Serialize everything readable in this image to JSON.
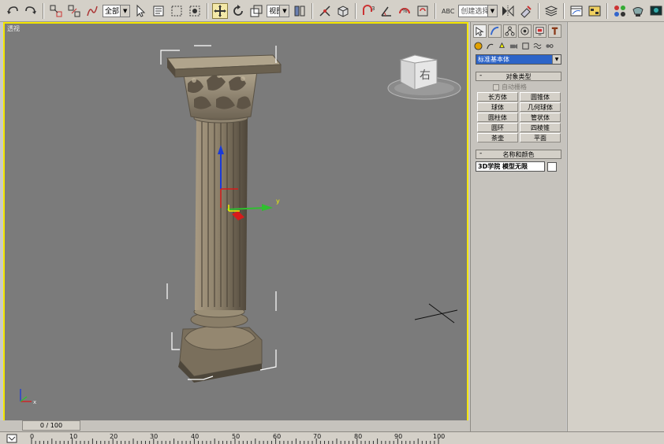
{
  "toolbar": {
    "selection_filter": "全部",
    "reference_coord": "视图",
    "named_selection_set": "创建选择集",
    "active_tool": "move-tool"
  },
  "viewport": {
    "label": "透视",
    "viewcube_face": "右",
    "axis_y_label": "y",
    "axis_x_label": "x",
    "gizmo_y_label": "y"
  },
  "command_panel": {
    "category": "标准基本体",
    "object_type_title": "对象类型",
    "auto_grid_label": "自动栅格",
    "object_buttons": [
      "长方体",
      "圆锥体",
      "球体",
      "几何球体",
      "圆柱体",
      "管状体",
      "圆环",
      "四棱锥",
      "茶壶",
      "平面"
    ],
    "name_color_title": "名称和颜色",
    "object_name": "3D学院 模型无限",
    "rollout_minus": "-"
  },
  "timeline": {
    "time_slider": "0 / 100",
    "ticks": [
      "0",
      "10",
      "20",
      "30",
      "40",
      "50",
      "60",
      "70",
      "80",
      "90",
      "100"
    ]
  },
  "colors": {
    "viewport_bg": "#7b7b7b",
    "active_viewport_border": "#f4e600",
    "gizmo_x": "#2fbf2f",
    "gizmo_y": "#1a3ad8",
    "gizmo_z": "#d81a1a",
    "column_stone": "#8f8470",
    "selection_highlight": "#2c64c8"
  }
}
